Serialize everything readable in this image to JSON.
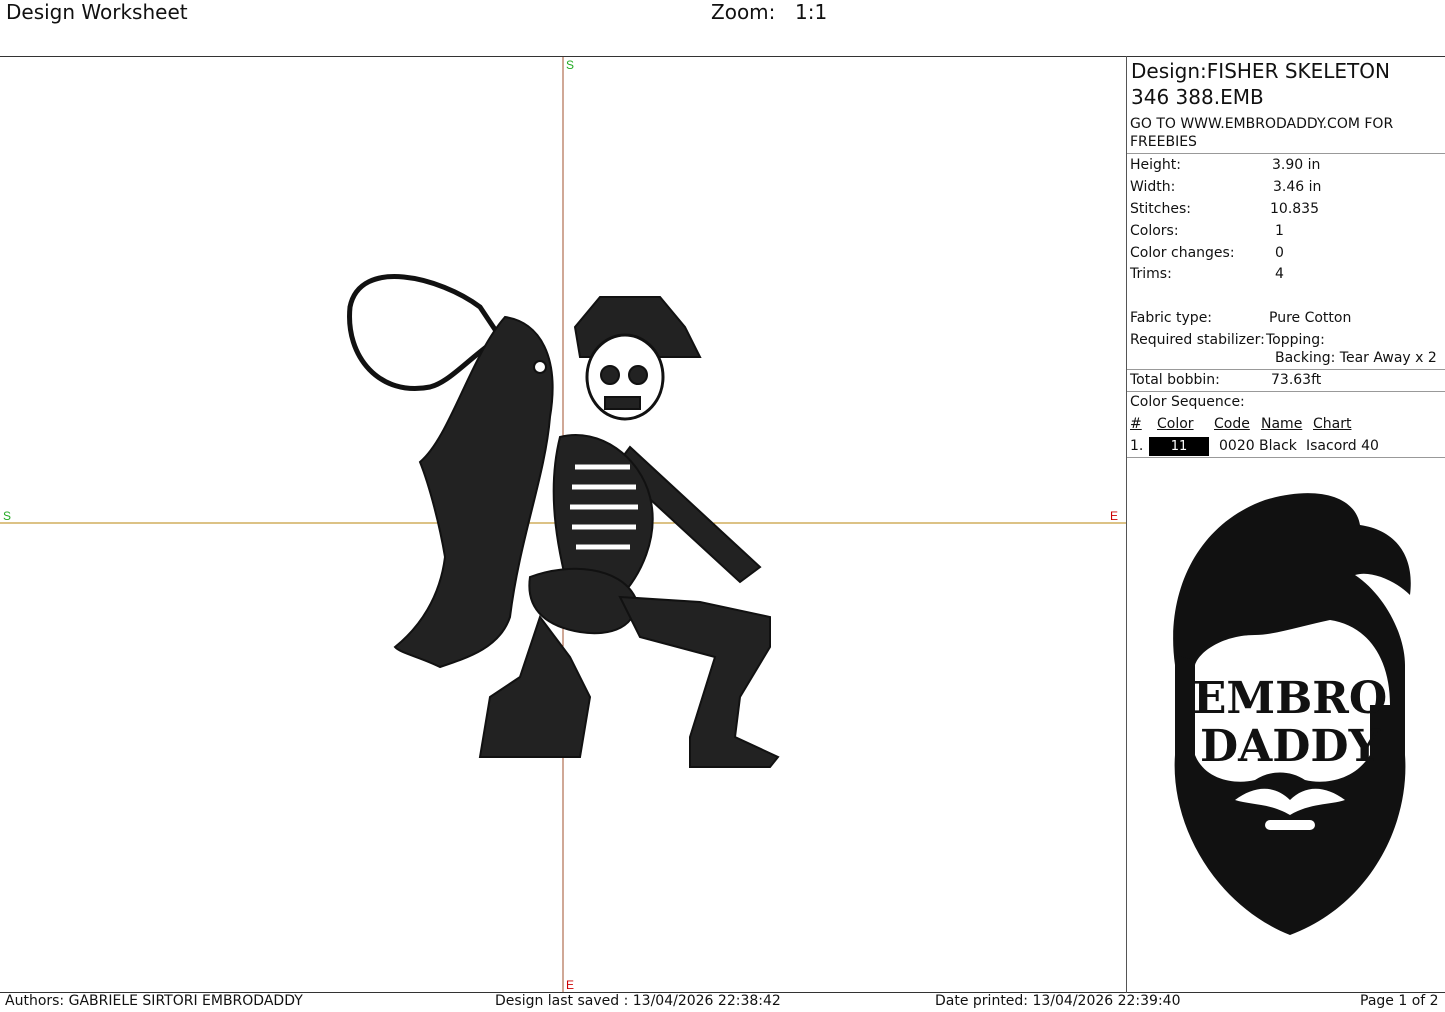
{
  "header": {
    "title": "Design Worksheet",
    "zoom_label": "Zoom:",
    "zoom_value": "1:1"
  },
  "canvas": {
    "axis_start": "S",
    "axis_end": "E",
    "axis_color_vertical": "#a0522d",
    "axis_color_horizontal": "#b8860b",
    "start_color": "#22aa22",
    "end_color": "#cc0000",
    "design_icon": "fisher-skeleton-embroidery"
  },
  "info": {
    "design_line1": "Design:FISHER SKELETON",
    "design_line2": "346 388.EMB",
    "note": "GO TO WWW.EMBRODADDY.COM FOR FREEBIES",
    "rows": [
      {
        "label": "Height:",
        "value": "3.90 in"
      },
      {
        "label": "Width:",
        "value": "3.46 in"
      },
      {
        "label": "Stitches:",
        "value": "10.835"
      },
      {
        "label": "Colors:",
        "value": "1"
      },
      {
        "label": "Color changes:",
        "value": "0"
      },
      {
        "label": "Trims:",
        "value": "4"
      }
    ],
    "fabric_label": "Fabric type:",
    "fabric_value": "Pure Cotton",
    "stabilizer_label": "Required stabilizer:",
    "topping": "Topping:",
    "backing": "Backing: Tear Away x 2",
    "bobbin_label": "Total bobbin:",
    "bobbin_value": "73.63ft",
    "sequence_label": "Color Sequence:",
    "seq_headers": [
      "#",
      "Color",
      "Code",
      "Name",
      "Chart"
    ],
    "seq_rows": [
      {
        "num": "1.",
        "color": "11",
        "code": "0020",
        "name": "Black",
        "chart": "Isacord 40",
        "swatch": "#000000"
      }
    ]
  },
  "logo": {
    "line1": "EMBRO",
    "line2": "DADDY"
  },
  "footer": {
    "authors": "Authors: GABRIELE SIRTORI EMBRODADDY",
    "saved": "Design last saved : 13/04/2026 22:38:42",
    "printed": "Date printed: 13/04/2026 22:39:40",
    "page": "Page 1 of 2"
  }
}
